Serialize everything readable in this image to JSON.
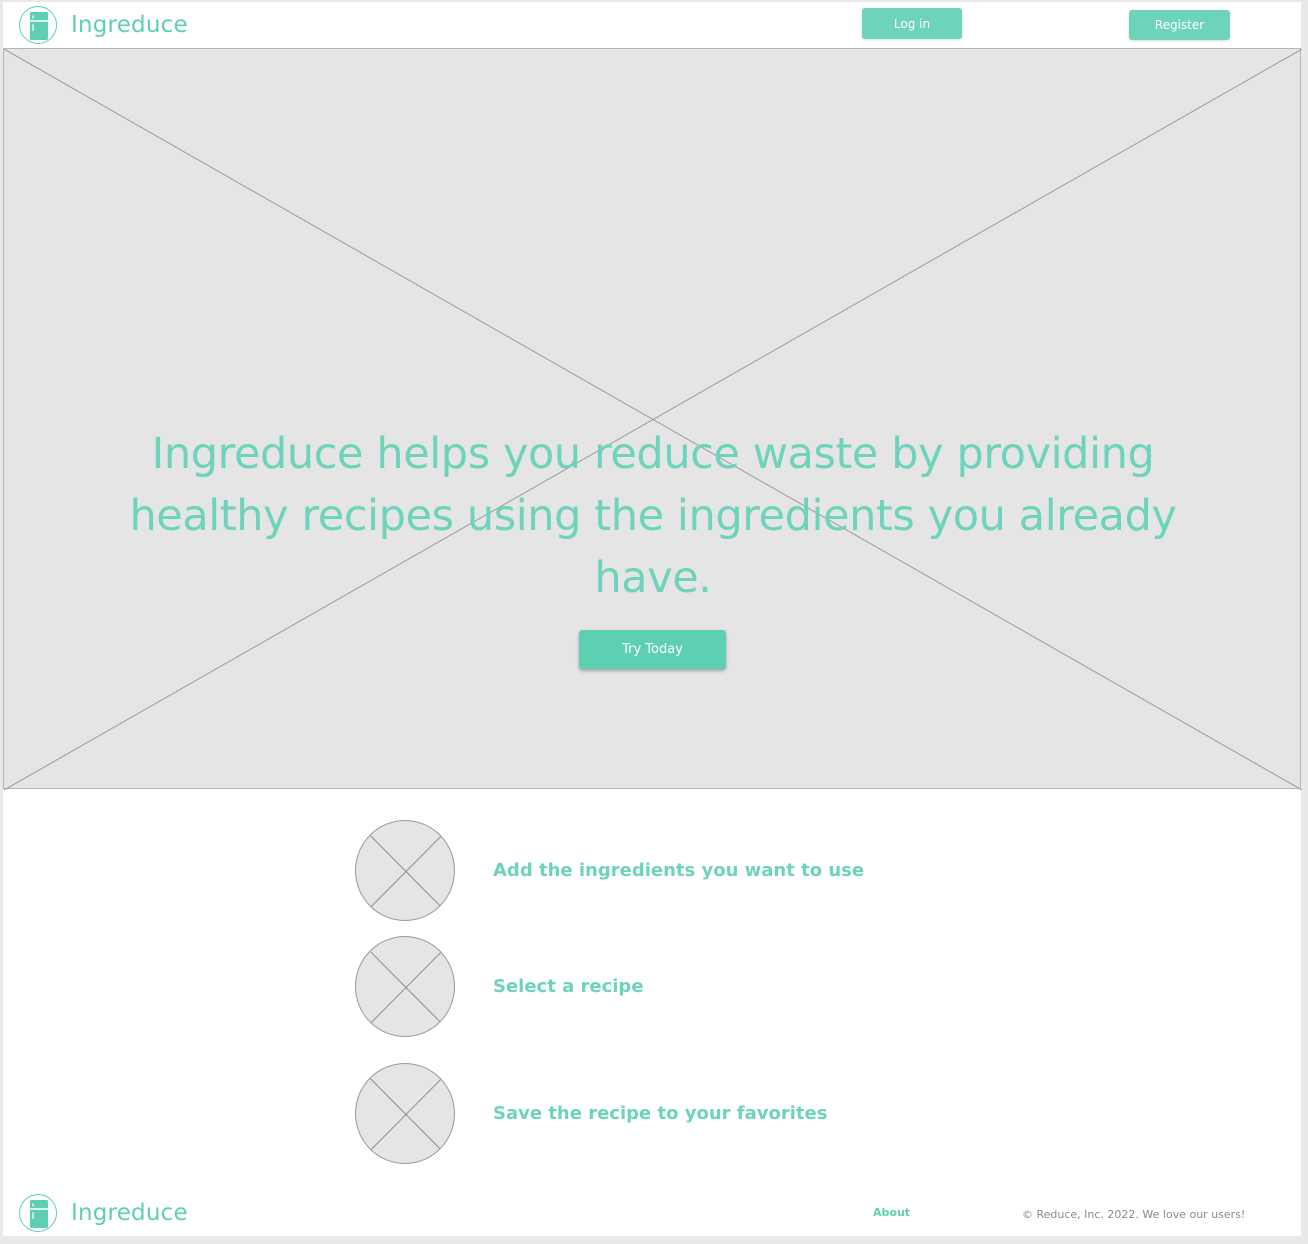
{
  "header": {
    "brand": "Ingreduce",
    "login_label": "Log in",
    "register_label": "Register"
  },
  "hero": {
    "headline": "Ingreduce helps you reduce waste by providing healthy recipes using the ingredients you already have.",
    "cta_label": "Try Today"
  },
  "steps": [
    {
      "label": "Add the ingredients you want to use",
      "icon": "image-placeholder-icon"
    },
    {
      "label": "Select a recipe",
      "icon": "image-placeholder-icon"
    },
    {
      "label": "Save the recipe to your favorites",
      "icon": "image-placeholder-icon"
    }
  ],
  "footer": {
    "brand": "Ingreduce",
    "about_label": "About",
    "copyright": "© Reduce, Inc. 2022. We love our users!"
  },
  "colors": {
    "accent": "#6dd3bb",
    "accent_dark": "#5ecfb2",
    "placeholder": "#e5e5e5",
    "muted_text": "#8a8a8a"
  },
  "icons": {
    "logo": "refrigerator-icon"
  }
}
